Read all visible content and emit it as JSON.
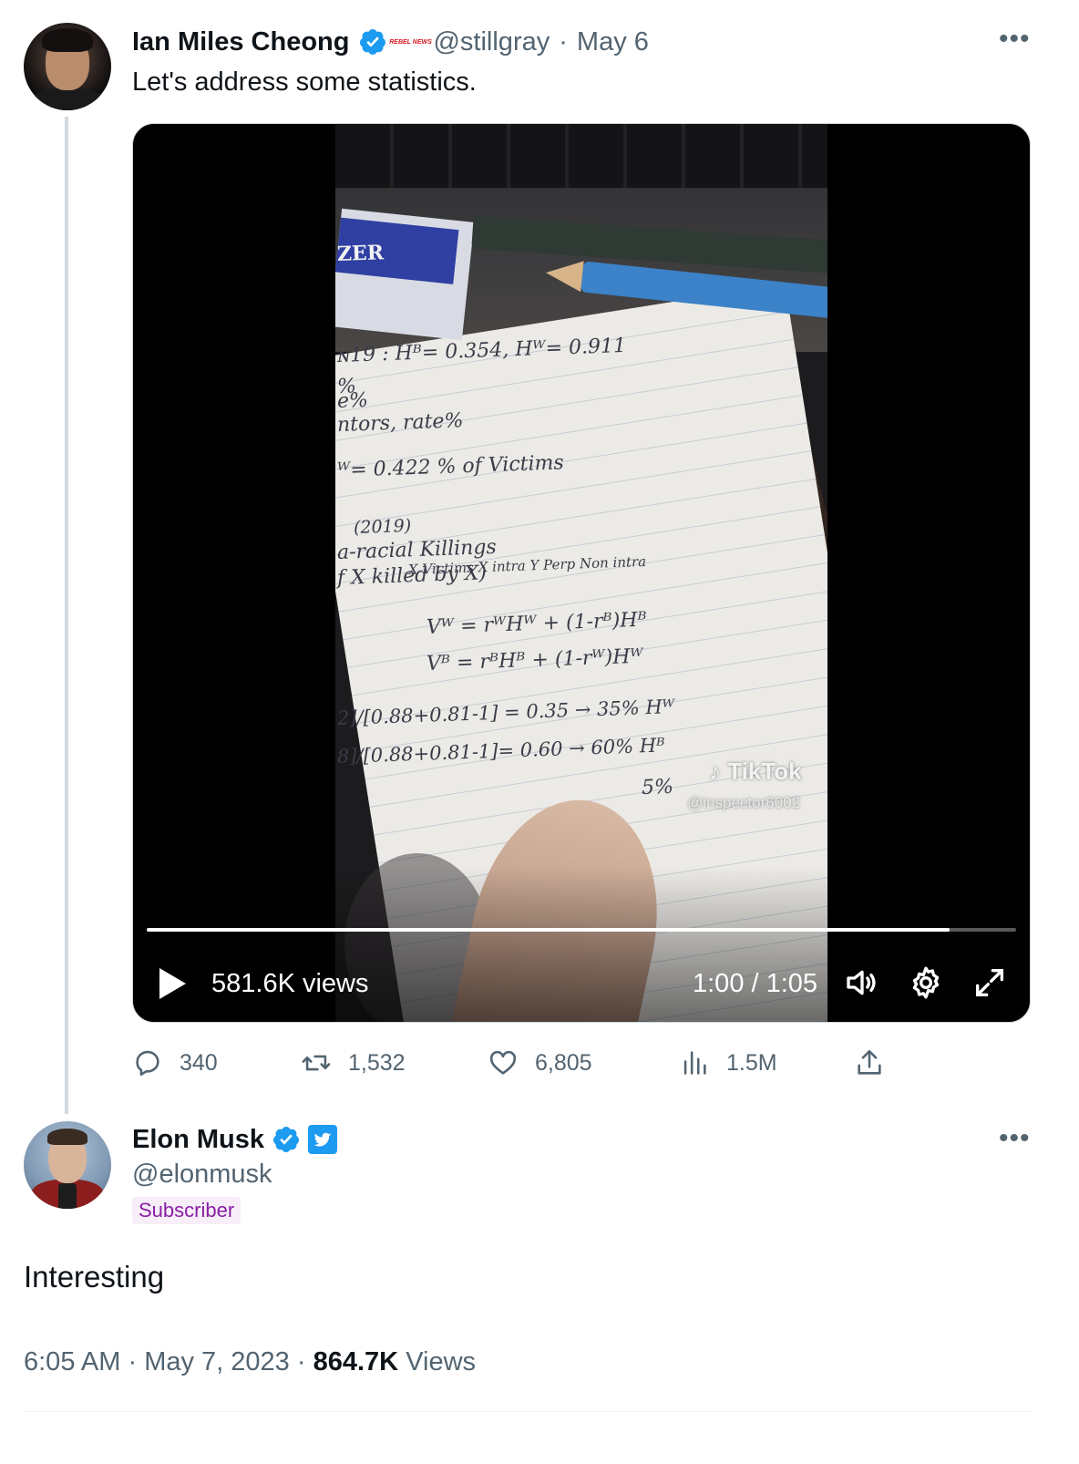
{
  "quoted_tweet": {
    "author_name": "Ian Miles Cheong",
    "affiliation_badge": "REBEL NEWS",
    "handle": "@stillgray",
    "separator": "·",
    "date": "May 6",
    "text": "Let's address some statistics.",
    "more_icon": "more-dots-icon",
    "video": {
      "views_label": "581.6K views",
      "time_label": "1:00 / 1:05",
      "progress": 0.923,
      "watermark_brand": "TikTok",
      "watermark_handle": "@inspector6002",
      "notes": [
        "ZER",
        "ɴ19 : Hᴮ= 0.354, Hᵂ= 0.911",
        "%",
        "e%",
        "ntors, rate%",
        "ᵂ= 0.422  % of Victims",
        "(2019)",
        "a-racial Killings",
        "f X killed by X)",
        "X Victims  X intra   Y Perp Non intra",
        "Vᵂ = rᵂHᵂ + (1-rᴮ)Hᴮ",
        "Vᴮ = rᴮHᴮ + (1-rᵂ)Hᵂ",
        "2]/[0.88+0.81-1] = 0.35 → 35%  Hᵂ",
        "8]/[0.88+0.81-1]= 0.60 → 60%  Hᴮ",
        "5%"
      ]
    },
    "stats": {
      "replies": "340",
      "retweets": "1,532",
      "likes": "6,805",
      "views": "1.5M"
    }
  },
  "main_tweet": {
    "author_name": "Elon Musk",
    "handle": "@elonmusk",
    "subscriber_label": "Subscriber",
    "text": "Interesting",
    "time": "6:05 AM",
    "date": "May 7, 2023",
    "separator": "·",
    "views_count": "864.7K",
    "views_label": "Views"
  },
  "colors": {
    "verified_blue": "#1d9bf0",
    "text_primary": "#0f1419",
    "text_secondary": "#536471",
    "subscriber_purple": "#8a1ea3"
  }
}
